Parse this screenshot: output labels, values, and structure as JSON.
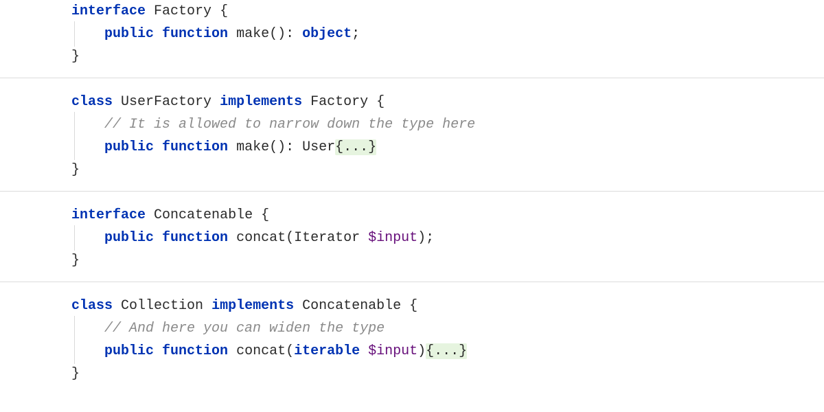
{
  "blocks": {
    "factory": {
      "l1_kw1": "interface",
      "l1_name": "Factory",
      "l2_kw1": "public",
      "l2_kw2": "function",
      "l2_fn": "make",
      "l2_ret": "object"
    },
    "userFactory": {
      "l1_kw1": "class",
      "l1_name": "UserFactory",
      "l1_kw2": "implements",
      "l1_base": "Factory",
      "l2_comment": "// It is allowed to narrow down the type here",
      "l3_kw1": "public",
      "l3_kw2": "function",
      "l3_fn": "make",
      "l3_ret": "User",
      "l3_body": "{...}"
    },
    "concatenable": {
      "l1_kw1": "interface",
      "l1_name": "Concatenable",
      "l2_kw1": "public",
      "l2_kw2": "function",
      "l2_fn": "concat",
      "l2_ptype": "Iterator",
      "l2_pvar": "$input"
    },
    "collection": {
      "l1_kw1": "class",
      "l1_name": "Collection",
      "l1_kw2": "implements",
      "l1_base": "Concatenable",
      "l2_comment": "// And here you can widen the type",
      "l3_kw1": "public",
      "l3_kw2": "function",
      "l3_fn": "concat",
      "l3_ptype": "iterable",
      "l3_pvar": "$input",
      "l3_body": "{...}"
    }
  }
}
